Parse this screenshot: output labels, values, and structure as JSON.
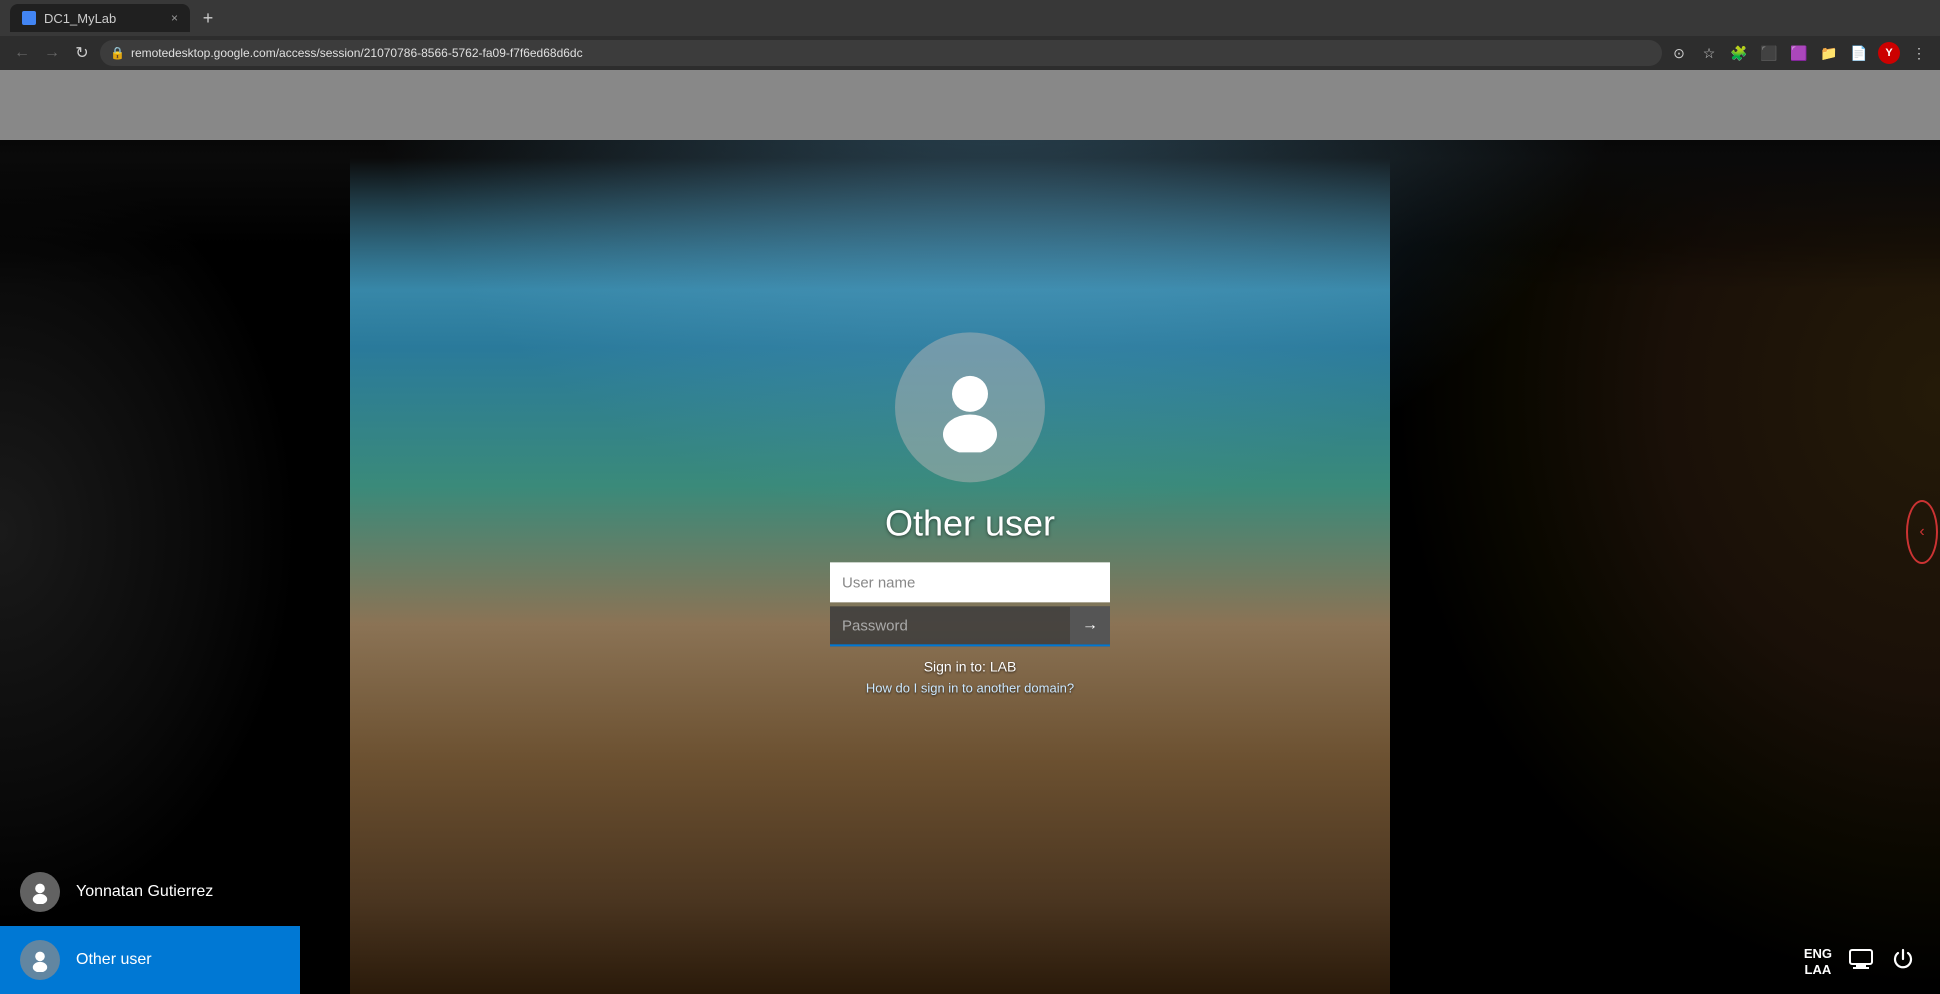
{
  "browser": {
    "tab_title": "DC1_MyLab",
    "url": "remotedesktop.google.com/access/session/21070786-8566-5762-fa09-f7f6ed68d6dc",
    "new_tab_label": "+",
    "close_tab_label": "×",
    "nav": {
      "back_label": "←",
      "forward_label": "→",
      "refresh_label": "↻"
    }
  },
  "remote_toolbar": {
    "visible": true
  },
  "login": {
    "user_display_name": "Other user",
    "avatar_label": "user-avatar",
    "username_placeholder": "User name",
    "password_placeholder": "Password",
    "submit_label": "→",
    "sign_in_to": "Sign in to: LAB",
    "another_domain_label": "How do I sign in to another domain?"
  },
  "user_switcher": {
    "users": [
      {
        "name": "Yonnatan Gutierrez",
        "active": false
      },
      {
        "name": "Other user",
        "active": true
      }
    ]
  },
  "system_tray": {
    "language_line1": "ENG",
    "language_line2": "LAA",
    "network_icon": "🖥",
    "power_icon": "⏻"
  }
}
